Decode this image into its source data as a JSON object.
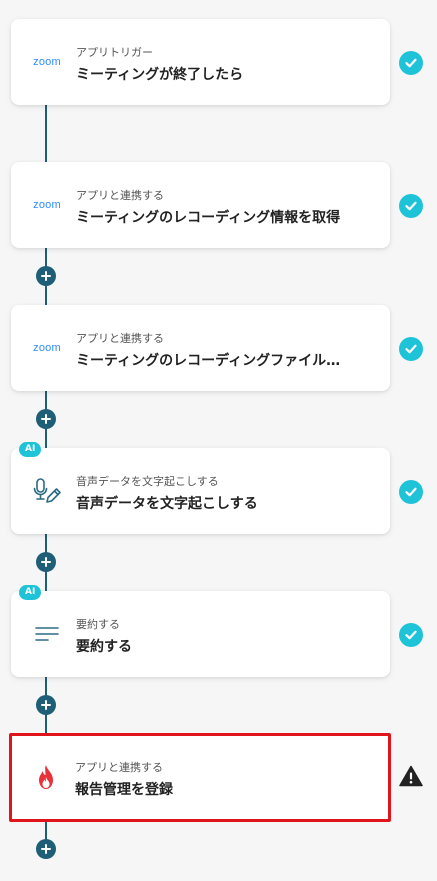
{
  "colors": {
    "connector": "#1f5e77",
    "success": "#1fc3d8",
    "selected_border": "#e0151b",
    "zoom_brand": "#2d8cff",
    "warning": "#222222"
  },
  "steps": [
    {
      "subtitle": "アプリトリガー",
      "title": "ミーティングが終了したら",
      "icon": "zoom-logo",
      "logo_text": "zoom",
      "status": "success"
    },
    {
      "subtitle": "アプリと連携する",
      "title": "ミーティングのレコーディング情報を取得",
      "icon": "zoom-logo",
      "logo_text": "zoom",
      "status": "success"
    },
    {
      "subtitle": "アプリと連携する",
      "title": "ミーティングのレコーディングファイル…",
      "icon": "zoom-logo",
      "logo_text": "zoom",
      "status": "success"
    },
    {
      "badge": "AI",
      "subtitle": "音声データを文字起こしする",
      "title": "音声データを文字起こしする",
      "icon": "microphone-pen-icon",
      "status": "success"
    },
    {
      "badge": "AI",
      "subtitle": "要約する",
      "title": "要約する",
      "icon": "summary-lines-icon",
      "status": "success"
    },
    {
      "subtitle": "アプリと連携する",
      "title": "報告管理を登録",
      "icon": "flame-icon",
      "status": "warning",
      "selected": true
    }
  ]
}
